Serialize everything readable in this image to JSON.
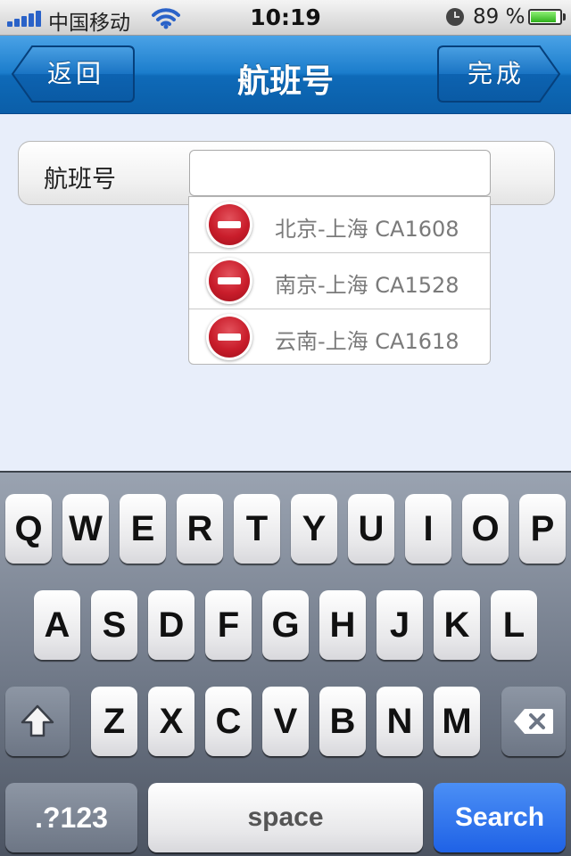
{
  "status_bar": {
    "carrier": "中国移动",
    "time": "10:19",
    "battery_percent_label": "89 %",
    "battery_level": 0.89,
    "icons": [
      "signal-icon",
      "wifi-icon",
      "alarm-clock-icon",
      "battery-icon"
    ]
  },
  "nav": {
    "title": "航班号",
    "back_label": "返回",
    "done_label": "完成"
  },
  "form": {
    "field_label": "航班号",
    "input_value": "",
    "input_placeholder": ""
  },
  "suggestions": [
    {
      "text": "北京-上海  CA1608",
      "icon": "delete-icon"
    },
    {
      "text": "南京-上海  CA1528",
      "icon": "delete-icon"
    },
    {
      "text": "云南-上海  CA1618",
      "icon": "delete-icon"
    }
  ],
  "keyboard": {
    "row1": [
      "Q",
      "W",
      "E",
      "R",
      "T",
      "Y",
      "U",
      "I",
      "O",
      "P"
    ],
    "row2": [
      "A",
      "S",
      "D",
      "F",
      "G",
      "H",
      "J",
      "K",
      "L"
    ],
    "row3": [
      "Z",
      "X",
      "C",
      "V",
      "B",
      "N",
      "M"
    ],
    "numbers_label": ".?123",
    "space_label": "space",
    "search_label": "Search"
  },
  "colors": {
    "nav_blue": "#1b7dcc",
    "search_blue": "#1f62e6",
    "delete_red": "#c91d2b",
    "background": "#e8eefa"
  }
}
